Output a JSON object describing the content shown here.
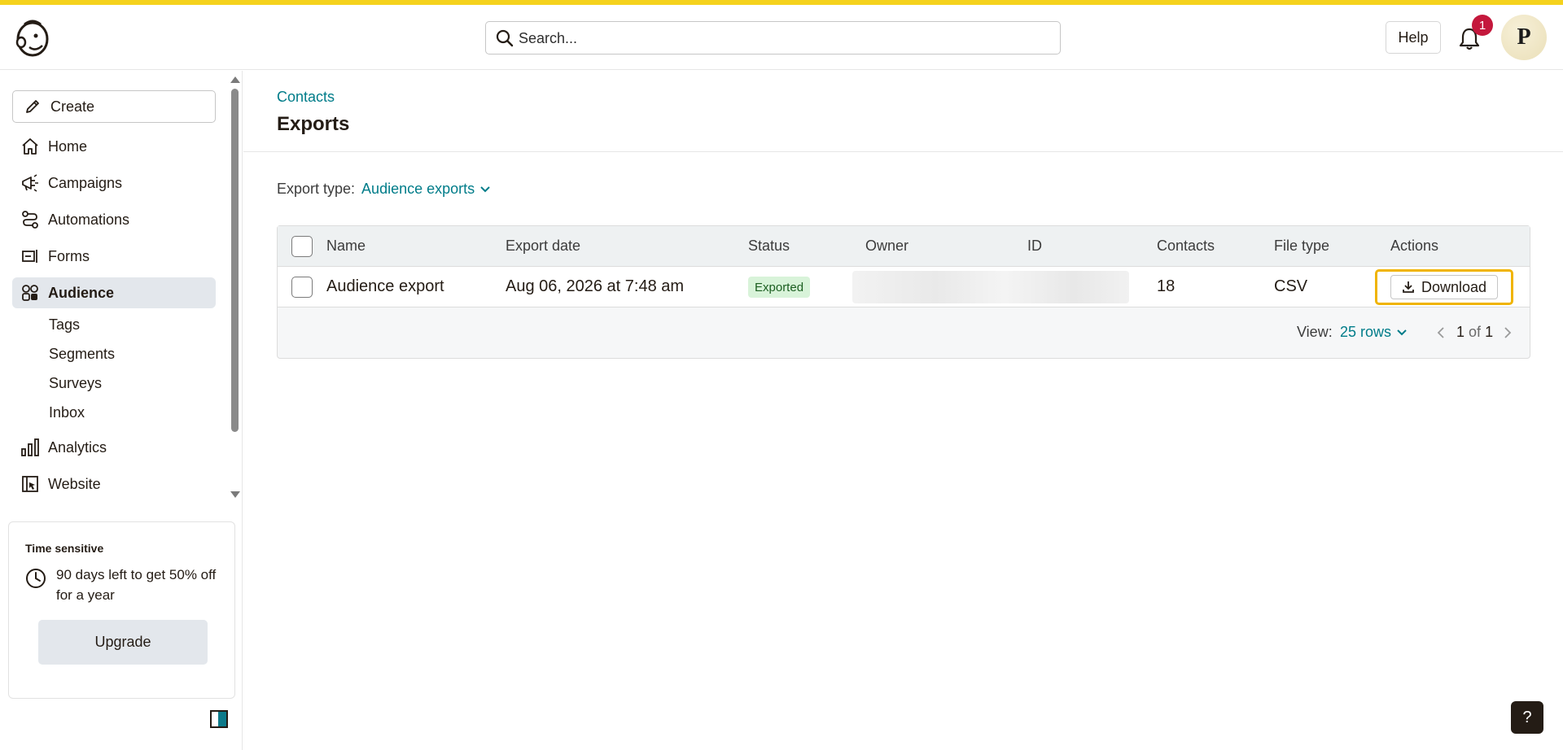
{
  "header": {
    "search_placeholder": "Search...",
    "help_label": "Help",
    "notification_count": "1",
    "avatar_initial": "P"
  },
  "sidebar": {
    "create_label": "Create",
    "items": [
      {
        "label": "Home",
        "icon": "home-icon"
      },
      {
        "label": "Campaigns",
        "icon": "megaphone-icon"
      },
      {
        "label": "Automations",
        "icon": "automation-icon"
      },
      {
        "label": "Forms",
        "icon": "forms-icon"
      },
      {
        "label": "Audience",
        "icon": "audience-icon",
        "active": true
      },
      {
        "label": "Analytics",
        "icon": "bar-chart-icon"
      },
      {
        "label": "Website",
        "icon": "website-icon"
      }
    ],
    "audience_sub_items": [
      "Tags",
      "Segments",
      "Surveys",
      "Inbox"
    ],
    "promo": {
      "tag": "Time sensitive",
      "message": "90 days left to get 50% off for a year",
      "button_label": "Upgrade"
    }
  },
  "main": {
    "breadcrumb": "Contacts",
    "title": "Exports",
    "export_type_label": "Export type:",
    "export_type_value": "Audience exports",
    "table": {
      "columns": [
        "Name",
        "Export date",
        "Status",
        "Owner",
        "ID",
        "Contacts",
        "File type",
        "Actions"
      ],
      "rows": [
        {
          "name": "Audience export",
          "export_date": "Aug 06, 2026 at 7:48 am",
          "status": "Exported",
          "contacts": "18",
          "file_type": "CSV",
          "action_label": "Download"
        }
      ]
    },
    "footer": {
      "view_label": "View:",
      "view_value": "25 rows",
      "page_current": "1",
      "page_of": "of",
      "page_total": "1"
    }
  },
  "help_fab_label": "?",
  "colors": {
    "accent_teal": "#007c89",
    "brand_yellow": "#f5d21d",
    "highlight_outline": "#f0b400",
    "badge_red": "#c4183c",
    "status_green_bg": "#d8f3d9"
  }
}
